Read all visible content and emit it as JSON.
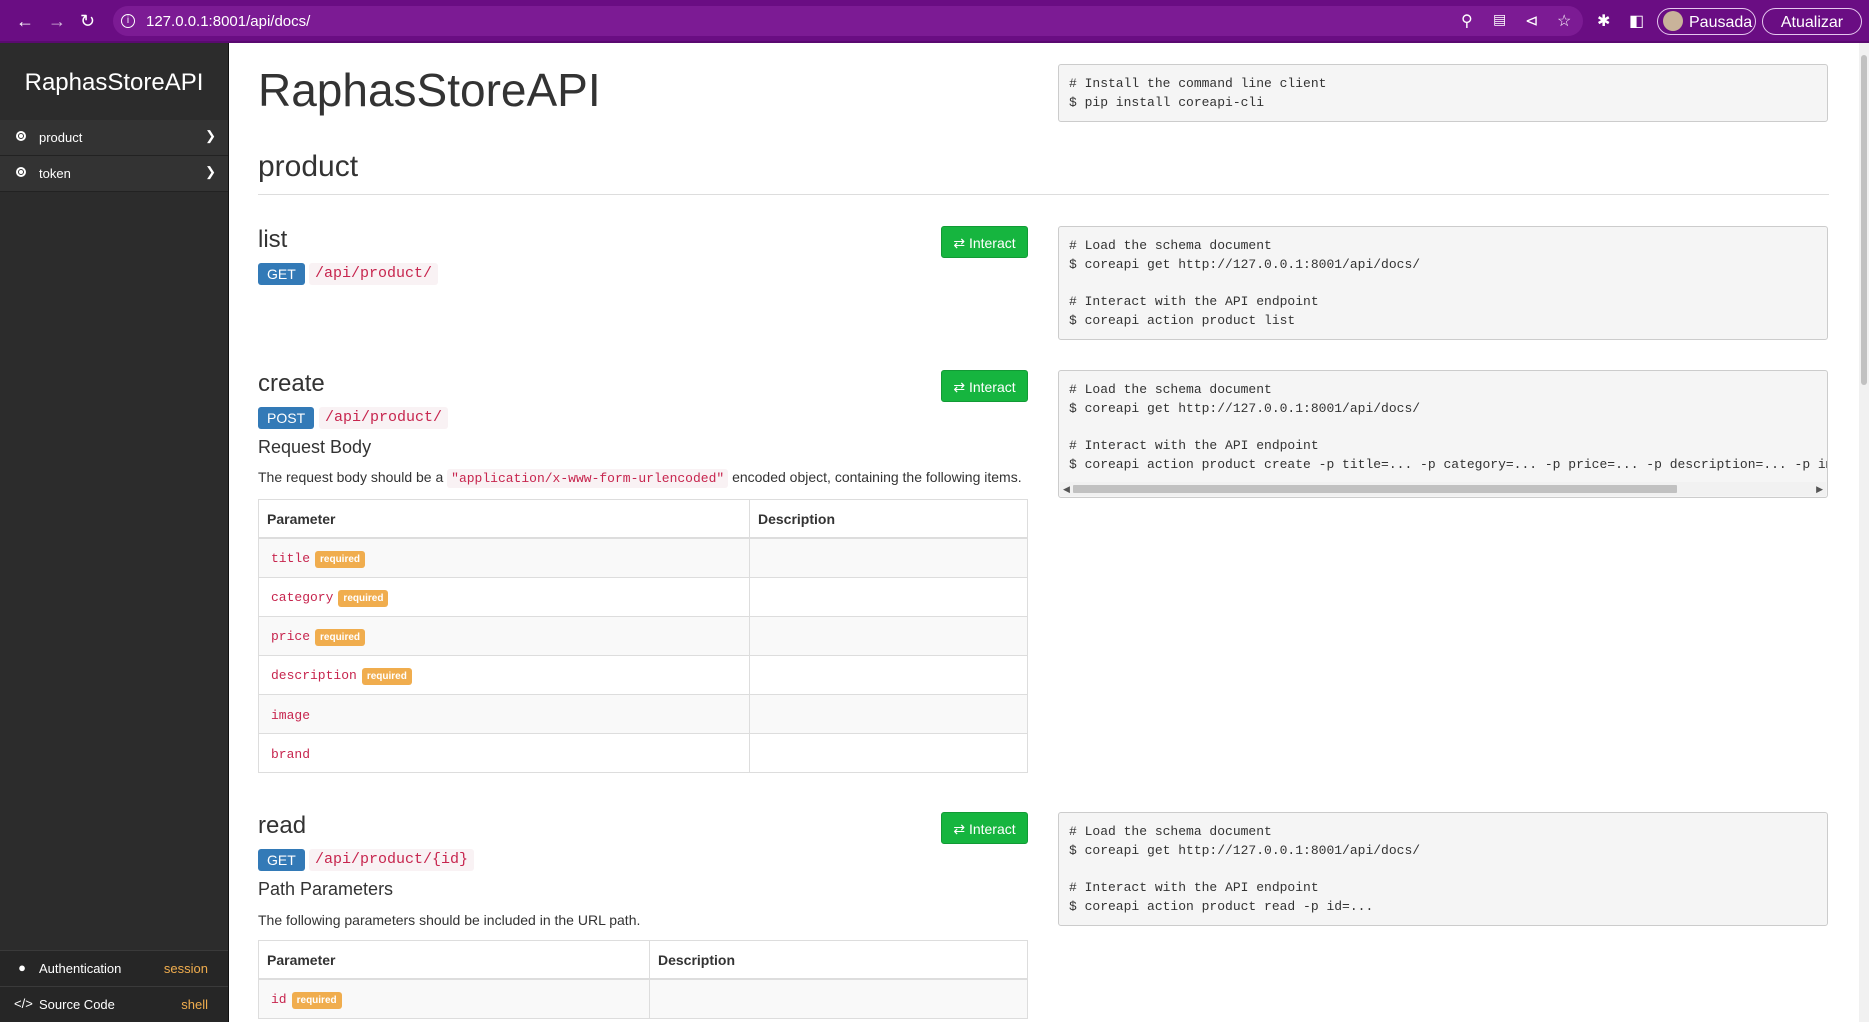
{
  "browser": {
    "url": "127.0.0.1:8001/api/docs/",
    "profile_label": "Pausada",
    "update_label": "Atualizar",
    "back_icon": "arrow-left-icon",
    "forward_icon": "arrow-right-icon",
    "reload_icon": "reload-icon"
  },
  "sidebar": {
    "brand": "RaphasStoreAPI",
    "items": [
      {
        "label": "product"
      },
      {
        "label": "token"
      }
    ],
    "footer": [
      {
        "label": "Authentication",
        "value": "session"
      },
      {
        "label": "Source Code",
        "value": "shell"
      }
    ]
  },
  "main": {
    "title": "RaphasStoreAPI",
    "install_code": "# Install the command line client\n$ pip install coreapi-cli",
    "section": "product",
    "interact_label": "Interact",
    "endpoints": [
      {
        "name": "list",
        "method": "GET",
        "path": "/api/product/",
        "code": "# Load the schema document\n$ coreapi get http://127.0.0.1:8001/api/docs/\n\n# Interact with the API endpoint\n$ coreapi action product list"
      },
      {
        "name": "create",
        "method": "POST",
        "path": "/api/product/",
        "body_heading": "Request Body",
        "body_desc_pre": "The request body should be a ",
        "body_desc_code": "\"application/x-www-form-urlencoded\"",
        "body_desc_post": " encoded object, containing the following items.",
        "table_headers": [
          "Parameter",
          "Description"
        ],
        "params": [
          {
            "name": "title",
            "required": "required"
          },
          {
            "name": "category",
            "required": "required"
          },
          {
            "name": "price",
            "required": "required"
          },
          {
            "name": "description",
            "required": "required"
          },
          {
            "name": "image",
            "required": ""
          },
          {
            "name": "brand",
            "required": ""
          }
        ],
        "code": "# Load the schema document\n$ coreapi get http://127.0.0.1:8001/api/docs/\n\n# Interact with the API endpoint\n$ coreapi action product create -p title=... -p category=... -p price=... -p description=... -p image=... -p brand=..."
      },
      {
        "name": "read",
        "method": "GET",
        "path": "/api/product/{id}",
        "params_heading": "Path Parameters",
        "params_desc": "The following parameters should be included in the URL path.",
        "table_headers": [
          "Parameter",
          "Description"
        ],
        "params": [
          {
            "name": "id",
            "required": "required"
          }
        ],
        "code": "# Load the schema document\n$ coreapi get http://127.0.0.1:8001/api/docs/\n\n# Interact with the API endpoint\n$ coreapi action product read -p id=..."
      }
    ]
  }
}
